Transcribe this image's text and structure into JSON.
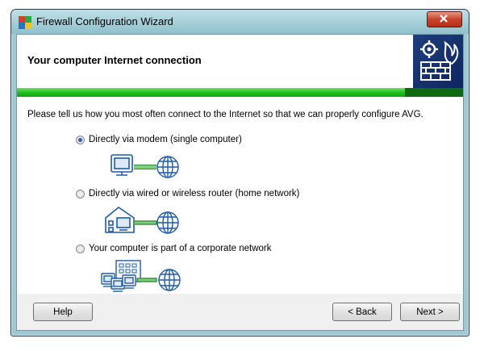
{
  "window": {
    "title": "Firewall Configuration Wizard"
  },
  "header": {
    "title": "Your computer Internet connection"
  },
  "progress": {
    "fraction": 0.87
  },
  "intro": "Please tell us how you most often connect to the Internet so that we can properly configure AVG.",
  "options": [
    {
      "label": "Directly via modem (single computer)",
      "selected": true
    },
    {
      "label": "Directly via wired or wireless router (home network)",
      "selected": false
    },
    {
      "label": "Your computer is part of a corporate network",
      "selected": false
    }
  ],
  "buttons": {
    "help": "Help",
    "back": "< Back",
    "next": "Next >"
  },
  "colors": {
    "progress_green": "#1fc31f",
    "header_art": "#1f3e7c",
    "line": "#3a8a3a"
  }
}
